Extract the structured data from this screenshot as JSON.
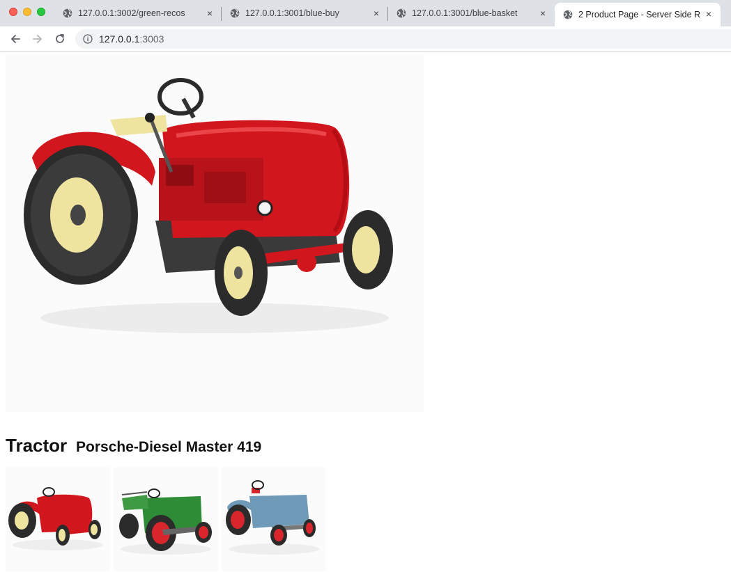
{
  "tabs": [
    {
      "title": "127.0.0.1:3002/green-recos",
      "active": false
    },
    {
      "title": "127.0.0.1:3001/blue-buy",
      "active": false
    },
    {
      "title": "127.0.0.1:3001/blue-basket",
      "active": false
    },
    {
      "title": "2 Product Page - Server Side R",
      "active": true
    }
  ],
  "tab_close_glyph": "×",
  "address_bar": {
    "host": "127.0.0.1",
    "port": ":3003"
  },
  "product": {
    "category": "Tractor",
    "name": "Porsche-Diesel Master 419"
  },
  "variants": [
    {
      "color_name": "red",
      "body": "#d2161e",
      "wheel": "#efe3a0"
    },
    {
      "color_name": "green",
      "body": "#2e8b36",
      "wheel": "#d8262c"
    },
    {
      "color_name": "blue",
      "body": "#6e9ab8",
      "wheel": "#d8262c"
    }
  ],
  "colors": {
    "tab_strip": "#dee1e6",
    "omnibox": "#f1f3f4",
    "hero_body": "#d2161e",
    "hero_wheel": "#efe3a0"
  },
  "icons": [
    "globe-icon",
    "close-icon",
    "back-arrow-icon",
    "forward-arrow-icon",
    "reload-icon",
    "info-icon"
  ]
}
